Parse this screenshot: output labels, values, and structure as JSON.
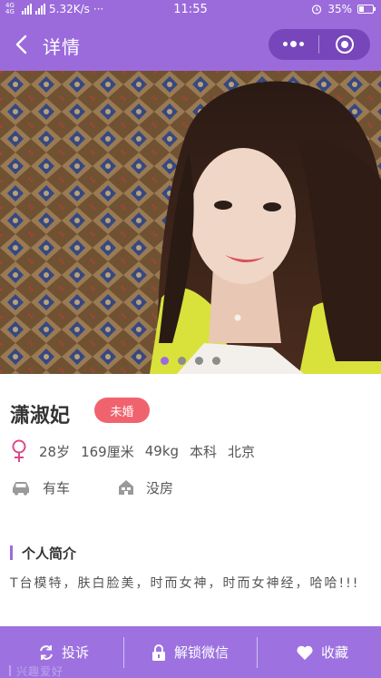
{
  "status_bar": {
    "network": "4G 4G",
    "speed": "5.32K/s",
    "more": "···",
    "time": "11:55",
    "battery": "35%"
  },
  "nav": {
    "title": "详情"
  },
  "photo": {
    "slide_count": 4,
    "active_index": 0
  },
  "profile": {
    "name": "潇淑妃",
    "marital_badge": "未婚",
    "age": "28岁",
    "height": "169厘米",
    "weight": "49kg",
    "education": "本科",
    "city": "北京",
    "car": "有车",
    "house": "没房"
  },
  "intro": {
    "title": "个人简介",
    "text": "T台模特，肤白脸美，时而女神，时而女神经，哈哈!!!"
  },
  "bottom_bar": {
    "report": "投诉",
    "unlock_wechat": "解锁微信",
    "favorite": "收藏"
  },
  "overlay_text": "兴趣爱好",
  "colors": {
    "accent": "#9b6bdc",
    "badge": "#f0636e",
    "female": "#d94a8c"
  }
}
